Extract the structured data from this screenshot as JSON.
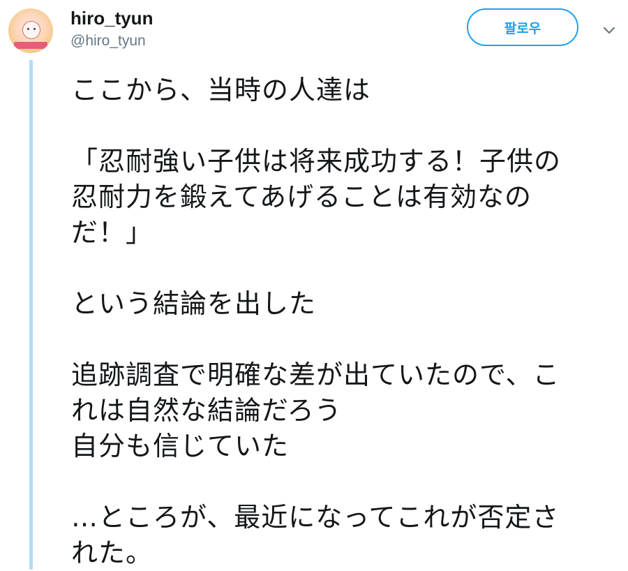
{
  "user": {
    "display_name": "hiro_tyun",
    "handle": "@hiro_tyun",
    "avatar_icon": "anime-avatar-icon"
  },
  "actions": {
    "follow_label": "팔로우",
    "more_icon": "chevron-down-icon"
  },
  "colors": {
    "accent": "#1da1f2",
    "thread_line": "#b3dcf7",
    "text": "#14171a",
    "secondary_text": "#657786"
  },
  "tweet": {
    "lines": [
      "ここから、当時の人達は",
      "",
      "「忍耐強い子供は将来成功する！子供の",
      "忍耐力を鍛えてあげることは有効なの",
      "だ！」",
      "",
      "という結論を出した",
      "",
      "追跡調査で明確な差が出ていたので、こ",
      "れは自然な結論だろう",
      "自分も信じていた",
      "",
      "…ところが、最近になってこれが否定さ",
      "れた。"
    ]
  }
}
